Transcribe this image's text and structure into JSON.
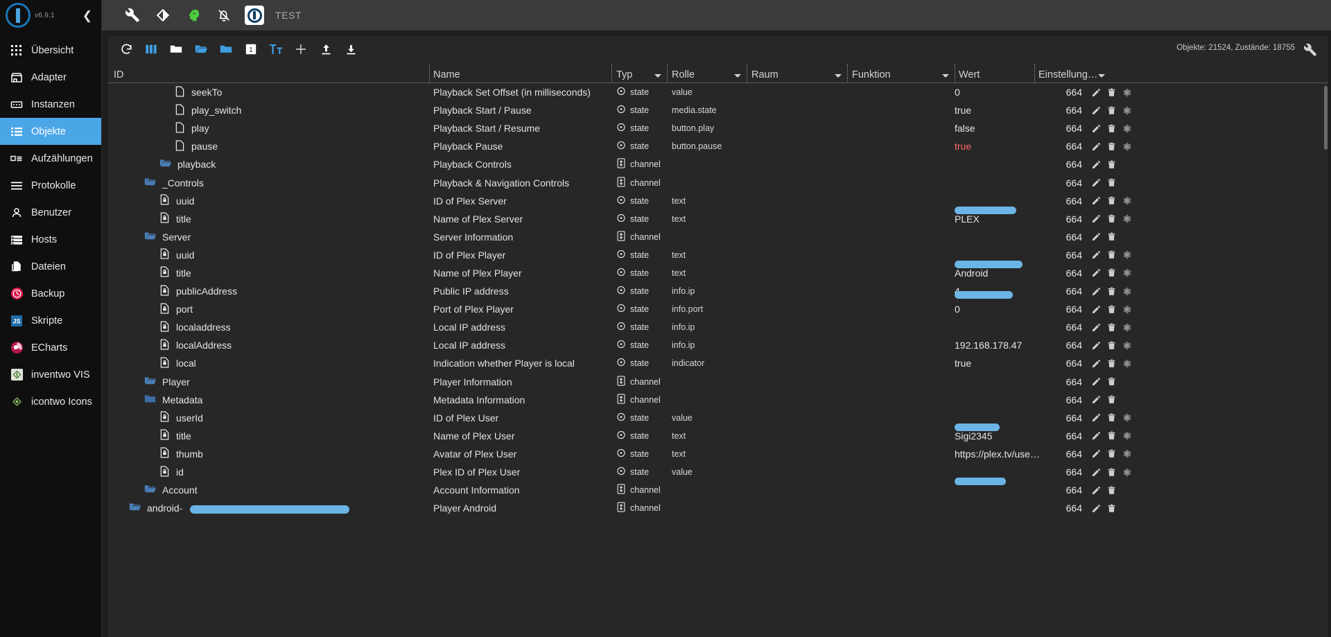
{
  "sidebar": {
    "version": "v6.9.1",
    "collapse_icon": "chevron-left-icon",
    "items": [
      {
        "label": "Übersicht",
        "icon": "grid-icon",
        "active": false
      },
      {
        "label": "Adapter",
        "icon": "store-icon",
        "active": false
      },
      {
        "label": "Instanzen",
        "icon": "instances-icon",
        "active": false
      },
      {
        "label": "Objekte",
        "icon": "list-icon",
        "active": true
      },
      {
        "label": "Aufzählungen",
        "icon": "enum-icon",
        "active": false
      },
      {
        "label": "Protokolle",
        "icon": "logs-icon",
        "active": false
      },
      {
        "label": "Benutzer",
        "icon": "user-icon",
        "active": false
      },
      {
        "label": "Hosts",
        "icon": "hosts-icon",
        "active": false
      },
      {
        "label": "Dateien",
        "icon": "files-icon",
        "active": false
      },
      {
        "label": "Backup",
        "icon": "backup-clock-icon",
        "active": false
      },
      {
        "label": "Skripte",
        "icon": "js-icon",
        "active": false
      },
      {
        "label": "ECharts",
        "icon": "echarts-icon",
        "active": false
      },
      {
        "label": "inventwo VIS",
        "icon": "inventwo-vis-icon",
        "active": false
      },
      {
        "label": "icontwo Icons",
        "icon": "icontwo-icons-icon",
        "active": false
      }
    ]
  },
  "topbar": {
    "title": "TEST",
    "buttons": [
      {
        "name": "wrench-icon"
      },
      {
        "name": "theme-contrast-icon"
      },
      {
        "name": "expert-mode-head-icon"
      },
      {
        "name": "notifications-off-icon"
      },
      {
        "name": "iobroker-logo-icon"
      }
    ]
  },
  "toolbar": {
    "buttons": [
      {
        "name": "refresh-icon"
      },
      {
        "name": "columns-icon"
      },
      {
        "name": "collapse-all-folders-icon"
      },
      {
        "name": "expand-folder-icon"
      },
      {
        "name": "expand-all-folders-icon"
      },
      {
        "name": "depth-level-1-icon",
        "label": "1"
      },
      {
        "name": "text-size-icon"
      },
      {
        "name": "add-object-icon"
      },
      {
        "name": "import-icon"
      },
      {
        "name": "export-icon"
      }
    ],
    "status": "Objekte: 21524, Zustände: 18755",
    "settings_icon": "wrench-icon"
  },
  "table": {
    "columns": [
      {
        "key": "id",
        "label": "ID",
        "sortable": false
      },
      {
        "key": "name",
        "label": "Name",
        "sortable": false
      },
      {
        "key": "typ",
        "label": "Typ",
        "sortable": true
      },
      {
        "key": "rolle",
        "label": "Rolle",
        "sortable": true
      },
      {
        "key": "raum",
        "label": "Raum",
        "sortable": true
      },
      {
        "key": "funktion",
        "label": "Funktion",
        "sortable": true
      },
      {
        "key": "wert",
        "label": "Wert",
        "sortable": false
      },
      {
        "key": "einstellung",
        "label": "Einstellung…",
        "sortable": true
      }
    ],
    "rows": [
      {
        "id": "android-",
        "indent": 1,
        "icon": "folder-open-icon",
        "name": "Player Android",
        "typ": "channel",
        "typ_icon": "channel-icon",
        "rolle": "",
        "wert": "",
        "einstellung": "664",
        "gear": false,
        "redacted": true
      },
      {
        "id": "Account",
        "indent": 2,
        "icon": "folder-open-icon",
        "name": "Account Information",
        "typ": "channel",
        "typ_icon": "channel-icon",
        "rolle": "",
        "wert": "",
        "einstellung": "664",
        "gear": false
      },
      {
        "id": "id",
        "indent": 3,
        "icon": "state-doc-icon",
        "name": "Plex ID of Plex User",
        "typ": "state",
        "typ_icon": "state-icon",
        "rolle": "value",
        "wert": "",
        "einstellung": "664",
        "gear": true,
        "redacted_value": true
      },
      {
        "id": "thumb",
        "indent": 3,
        "icon": "state-doc-icon",
        "name": "Avatar of Plex User",
        "typ": "state",
        "typ_icon": "state-icon",
        "rolle": "text",
        "wert": "https://plex.tv/use…",
        "einstellung": "664",
        "gear": true
      },
      {
        "id": "title",
        "indent": 3,
        "icon": "state-doc-icon",
        "name": "Name of Plex User",
        "typ": "state",
        "typ_icon": "state-icon",
        "rolle": "text",
        "wert": "Sigi2345",
        "einstellung": "664",
        "gear": true
      },
      {
        "id": "userId",
        "indent": 3,
        "icon": "state-doc-icon",
        "name": "ID of Plex User",
        "typ": "state",
        "typ_icon": "state-icon",
        "rolle": "value",
        "wert": "",
        "einstellung": "664",
        "gear": true,
        "redacted_value": true
      },
      {
        "id": "Metadata",
        "indent": 2,
        "icon": "folder-closed-icon",
        "name": "Metadata Information",
        "typ": "channel",
        "typ_icon": "channel-icon",
        "rolle": "",
        "wert": "",
        "einstellung": "664",
        "gear": false
      },
      {
        "id": "Player",
        "indent": 2,
        "icon": "folder-open-icon",
        "name": "Player Information",
        "typ": "channel",
        "typ_icon": "channel-icon",
        "rolle": "",
        "wert": "",
        "einstellung": "664",
        "gear": false
      },
      {
        "id": "local",
        "indent": 3,
        "icon": "state-doc-icon",
        "name": "Indication whether Player is local",
        "typ": "state",
        "typ_icon": "state-icon",
        "rolle": "indicator",
        "wert": "true",
        "einstellung": "664",
        "gear": true
      },
      {
        "id": "localAddress",
        "indent": 3,
        "icon": "state-doc-icon",
        "name": "Local IP address",
        "typ": "state",
        "typ_icon": "state-icon",
        "rolle": "info.ip",
        "wert": "192.168.178.47",
        "einstellung": "664",
        "gear": true
      },
      {
        "id": "localaddress",
        "indent": 3,
        "icon": "state-doc-icon",
        "name": "Local IP address",
        "typ": "state",
        "typ_icon": "state-icon",
        "rolle": "info.ip",
        "wert": "",
        "einstellung": "664",
        "gear": true
      },
      {
        "id": "port",
        "indent": 3,
        "icon": "state-doc-icon",
        "name": "Port of Plex Player",
        "typ": "state",
        "typ_icon": "state-icon",
        "rolle": "info.port",
        "wert": "0",
        "einstellung": "664",
        "gear": true
      },
      {
        "id": "publicAddress",
        "indent": 3,
        "icon": "state-doc-icon",
        "name": "Public IP address",
        "typ": "state",
        "typ_icon": "state-icon",
        "rolle": "info.ip",
        "wert": "4",
        "einstellung": "664",
        "gear": true,
        "redacted_value": true
      },
      {
        "id": "title",
        "indent": 3,
        "icon": "state-doc-icon",
        "name": "Name of Plex Player",
        "typ": "state",
        "typ_icon": "state-icon",
        "rolle": "text",
        "wert": "Android",
        "einstellung": "664",
        "gear": true
      },
      {
        "id": "uuid",
        "indent": 3,
        "icon": "state-doc-icon",
        "name": "ID of Plex Player",
        "typ": "state",
        "typ_icon": "state-icon",
        "rolle": "text",
        "wert": "",
        "einstellung": "664",
        "gear": true,
        "redacted_value": true
      },
      {
        "id": "Server",
        "indent": 2,
        "icon": "folder-open-icon",
        "name": "Server Information",
        "typ": "channel",
        "typ_icon": "channel-icon",
        "rolle": "",
        "wert": "",
        "einstellung": "664",
        "gear": false
      },
      {
        "id": "title",
        "indent": 3,
        "icon": "state-doc-icon",
        "name": "Name of Plex Server",
        "typ": "state",
        "typ_icon": "state-icon",
        "rolle": "text",
        "wert": "PLEX",
        "einstellung": "664",
        "gear": true
      },
      {
        "id": "uuid",
        "indent": 3,
        "icon": "state-doc-icon",
        "name": "ID of Plex Server",
        "typ": "state",
        "typ_icon": "state-icon",
        "rolle": "text",
        "wert": "",
        "einstellung": "664",
        "gear": true,
        "redacted_value": true
      },
      {
        "id": "_Controls",
        "indent": 2,
        "icon": "folder-open-icon",
        "name": "Playback & Navigation Controls",
        "typ": "channel",
        "typ_icon": "channel-icon",
        "rolle": "",
        "wert": "",
        "einstellung": "664",
        "gear": false
      },
      {
        "id": "playback",
        "indent": 3,
        "icon": "folder-open-icon",
        "name": "Playback Controls",
        "typ": "channel",
        "typ_icon": "channel-icon",
        "rolle": "",
        "wert": "",
        "einstellung": "664",
        "gear": false
      },
      {
        "id": "pause",
        "indent": 4,
        "icon": "state-file-icon",
        "name": "Playback Pause",
        "typ": "state",
        "typ_icon": "state-icon",
        "rolle": "button.pause",
        "wert": "true",
        "wert_color": "red",
        "einstellung": "664",
        "gear": true
      },
      {
        "id": "play",
        "indent": 4,
        "icon": "state-file-icon",
        "name": "Playback Start / Resume",
        "typ": "state",
        "typ_icon": "state-icon",
        "rolle": "button.play",
        "wert": "false",
        "einstellung": "664",
        "gear": true
      },
      {
        "id": "play_switch",
        "indent": 4,
        "icon": "state-file-icon",
        "name": "Playback Start / Pause",
        "typ": "state",
        "typ_icon": "state-icon",
        "rolle": "media.state",
        "wert": "true",
        "einstellung": "664",
        "gear": true
      },
      {
        "id": "seekTo",
        "indent": 4,
        "icon": "state-file-icon",
        "name": "Playback Set Offset (in milliseconds)",
        "typ": "state",
        "typ_icon": "state-icon",
        "rolle": "value",
        "wert": "0",
        "einstellung": "664",
        "gear": true
      }
    ],
    "row_actions": [
      "edit-pencil-icon",
      "delete-trash-icon",
      "settings-gear-icon"
    ]
  },
  "colors": {
    "accent": "#4ba6e8",
    "sidebar_bg": "#0f0f0f",
    "topbar_bg": "#3b3b3b",
    "content_bg": "#272727",
    "redaction": "#6fbdf0",
    "value_true_red": "#ff6666"
  }
}
